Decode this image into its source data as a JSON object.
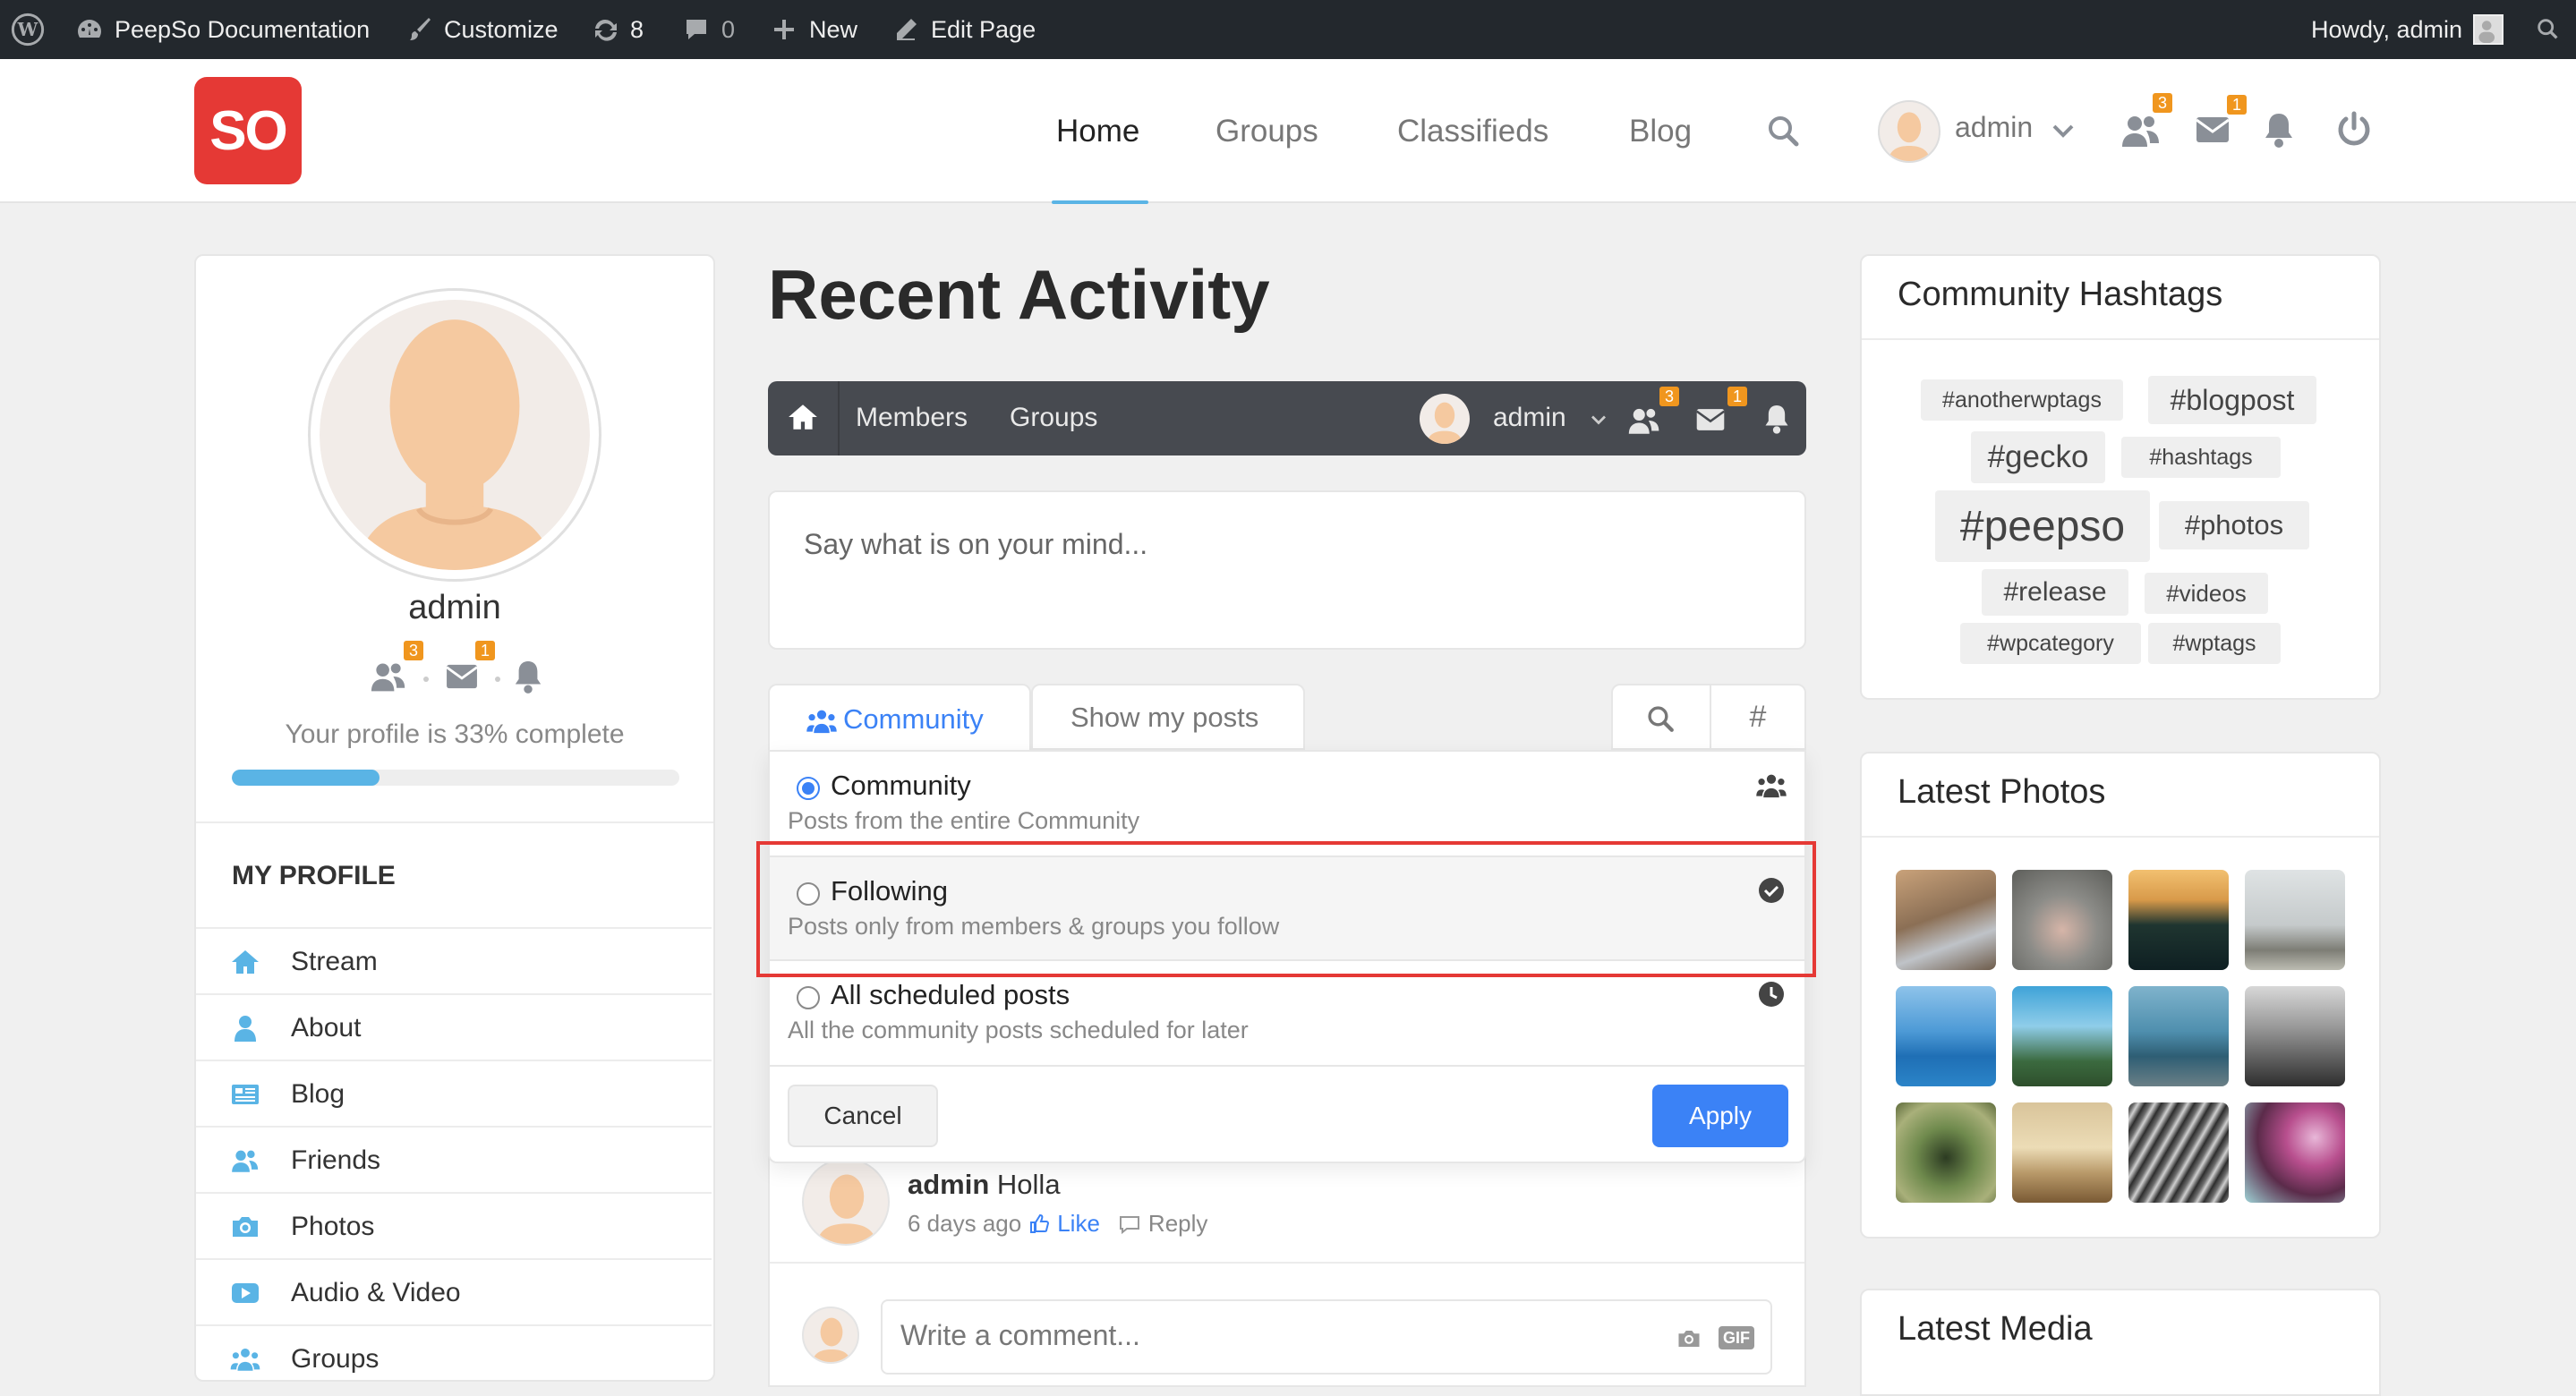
{
  "admin_bar": {
    "site_name": "PeepSo Documentation",
    "customize": "Customize",
    "updates_count": "8",
    "comments_count": "0",
    "new_label": "New",
    "edit_page": "Edit Page",
    "howdy": "Howdy, admin"
  },
  "header": {
    "logo_text": "SO",
    "nav": [
      "Home",
      "Groups",
      "Classifieds",
      "Blog"
    ],
    "active_nav": "Home",
    "user_name": "admin",
    "friends_badge": "3",
    "messages_badge": "1"
  },
  "profile": {
    "name": "admin",
    "friends_badge": "3",
    "messages_badge": "1",
    "completeness_text": "Your profile is 33% complete",
    "completeness_fraction": 0.33,
    "menu_heading": "MY PROFILE",
    "menu": [
      "Stream",
      "About",
      "Blog",
      "Friends",
      "Photos",
      "Audio & Video",
      "Groups"
    ]
  },
  "main": {
    "title": "Recent Activity",
    "toolbar": {
      "members": "Members",
      "groups": "Groups",
      "user_name": "admin",
      "friends_badge": "3",
      "messages_badge": "1"
    },
    "postbox_placeholder": "Say what is on your mind...",
    "filter_tabs": {
      "community": "Community",
      "show_my_posts": "Show my posts",
      "hashtag_symbol": "#"
    },
    "dropdown": {
      "options": [
        {
          "title": "Community",
          "desc": "Posts from the entire Community",
          "selected": true
        },
        {
          "title": "Following",
          "desc": "Posts only from members & groups you follow",
          "selected": false
        },
        {
          "title": "All scheduled posts",
          "desc": "All the community posts scheduled for later",
          "selected": false
        }
      ],
      "cancel": "Cancel",
      "apply": "Apply"
    },
    "comment": {
      "author": "admin",
      "text": "Holla",
      "time": "6 days ago",
      "like": "Like",
      "reply": "Reply"
    },
    "comment_placeholder": "Write a comment...",
    "gif_label": "GIF"
  },
  "right": {
    "hashtags_title": "Community Hashtags",
    "hashtags": [
      "#anotherwptags",
      "#blogpost",
      "#gecko",
      "#hashtags",
      "#peepso",
      "#photos",
      "#release",
      "#videos",
      "#wpcategory",
      "#wptags"
    ],
    "photos_title": "Latest Photos",
    "media_title": "Latest Media"
  },
  "colors": {
    "accent": "#3b82f6",
    "brand_red": "#e53935",
    "badge_orange": "#f0961e",
    "highlight_red": "#e53935",
    "menu_icon_blue": "#5ab4e5"
  }
}
